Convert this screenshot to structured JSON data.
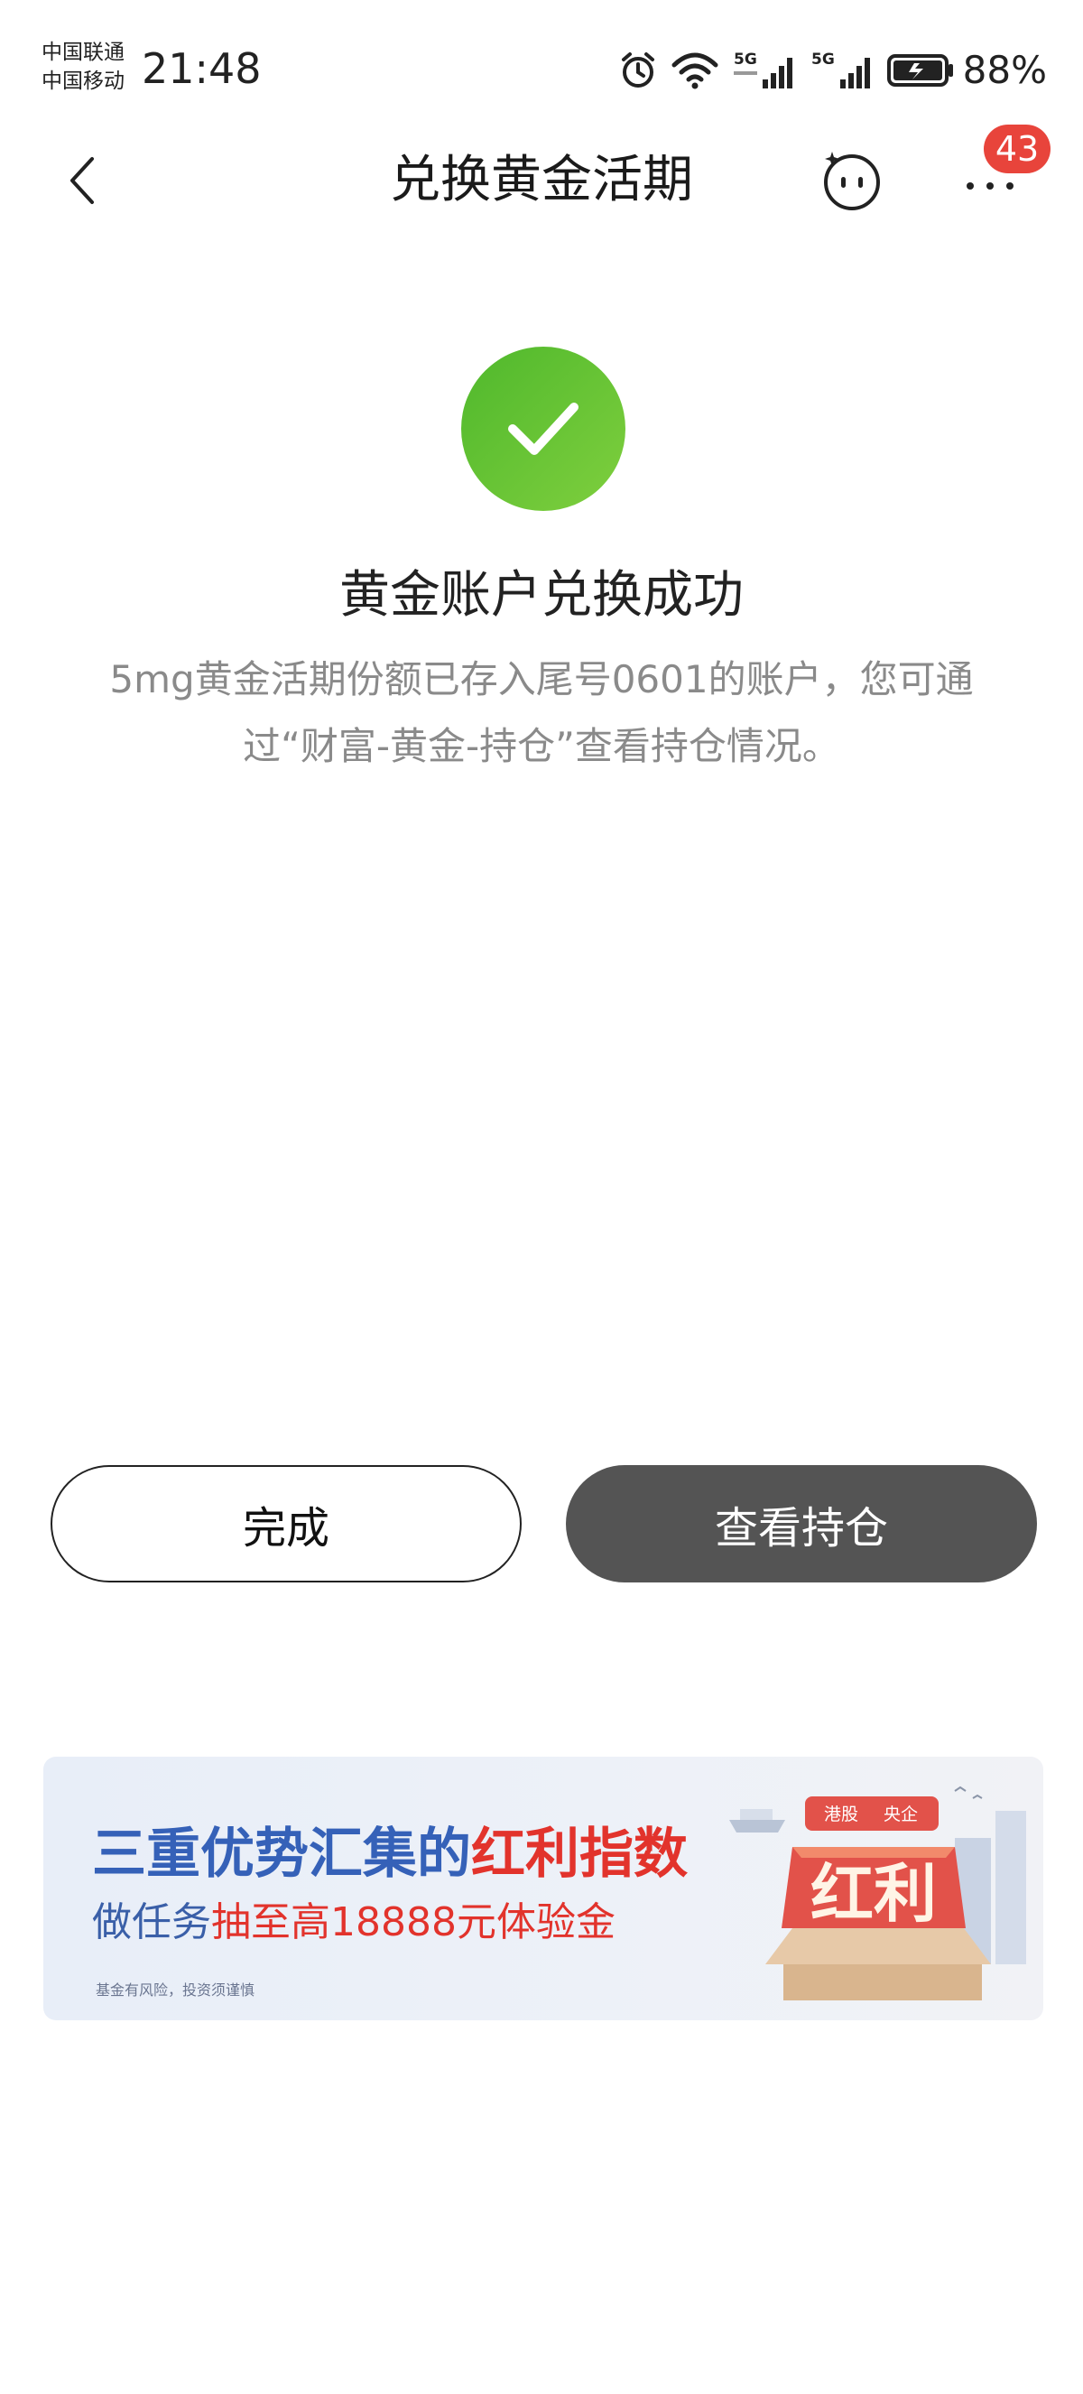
{
  "status_bar": {
    "carrier_1": "中国联通",
    "carrier_2": "中国移动",
    "time": "21:48",
    "network_1": "5G",
    "network_2": "5G",
    "battery_percent": "88%",
    "icons": [
      "alarm-icon",
      "wifi-icon",
      "signal-icon",
      "signal-icon",
      "battery-charging-icon"
    ]
  },
  "nav": {
    "title": "兑换黄金活期",
    "badge_count": "43",
    "icons": [
      "back-arrow-icon",
      "assistant-face-icon",
      "more-icon"
    ]
  },
  "result": {
    "status_icon": "checkmark-icon",
    "title": "黄金账户兑换成功",
    "description": "5mg黄金活期份额已存入尾号0601的账户，您可通过“财富-黄金-持仓”查看持仓情况。"
  },
  "actions": {
    "done_label": "完成",
    "view_holdings_label": "查看持仓"
  },
  "banner": {
    "headline_part1": "三重优势汇集的",
    "headline_part2": "红利指数",
    "subline_part1": "做任务",
    "subline_part2": "抽至高18888元体验金",
    "risk_notice": "基金有风险，投资须谨慎",
    "art_tag_1": "港股",
    "art_tag_2": "央企",
    "art_main_text": "红利"
  },
  "colors": {
    "success_green": "#5dbf33",
    "primary_button": "#545454",
    "badge_red": "#e8443b",
    "banner_blue": "#3561b8",
    "banner_red": "#e2332c"
  }
}
